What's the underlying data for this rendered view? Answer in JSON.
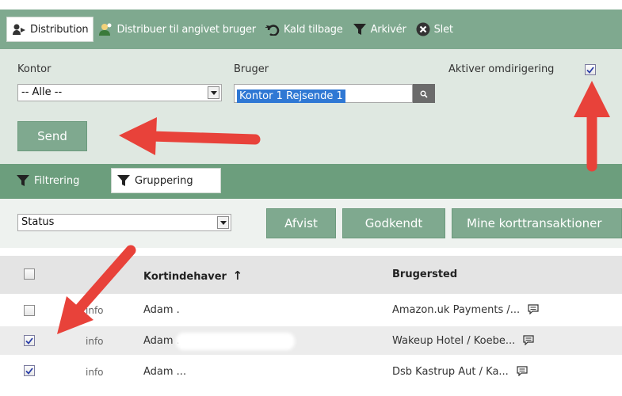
{
  "toolbar": {
    "items": [
      {
        "label": "Distribution",
        "icon": "distribution-icon"
      },
      {
        "label": "Distribuer til angivet bruger",
        "icon": "assign-user-icon"
      },
      {
        "label": "Kald tilbage",
        "icon": "undo-icon"
      },
      {
        "label": "Arkivér",
        "icon": "funnel-icon"
      },
      {
        "label": "Slet",
        "icon": "delete-icon"
      }
    ]
  },
  "form": {
    "kontor_label": "Kontor",
    "kontor_value": "-- Alle --",
    "bruger_label": "Bruger",
    "bruger_value": "Kontor 1 Rejsende 1",
    "redirect_label": "Aktiver omdirigering",
    "redirect_checked": true,
    "send_label": "Send"
  },
  "filterbar": {
    "tabs": [
      {
        "label": "Filtrering",
        "icon": "funnel-icon"
      },
      {
        "label": "Gruppering",
        "icon": "funnel-icon"
      }
    ]
  },
  "grouping": {
    "select_value": "Status",
    "buttons": [
      "Afvist",
      "Godkendt",
      "Mine korttransaktioner"
    ]
  },
  "grid": {
    "columns": {
      "cardholder": "Kortindehaver",
      "merchant": "Brugersted"
    },
    "sort_indicator": "↑",
    "rows": [
      {
        "checked": false,
        "info": "info",
        "cardholder": "Adam .",
        "merchant": "Amazon.uk Payments /..."
      },
      {
        "checked": true,
        "info": "info",
        "cardholder": "Adam ..",
        "merchant": "Wakeup Hotel / Koebe..."
      },
      {
        "checked": true,
        "info": "info",
        "cardholder": "Adam ...",
        "merchant": "Dsb Kastrup Aut / Ka..."
      }
    ]
  },
  "colors": {
    "toolbar_green": "#7fa98f",
    "panel_green": "#dfe8e1",
    "annotation_red": "#e8423a",
    "selection_blue": "#2f78d4"
  }
}
